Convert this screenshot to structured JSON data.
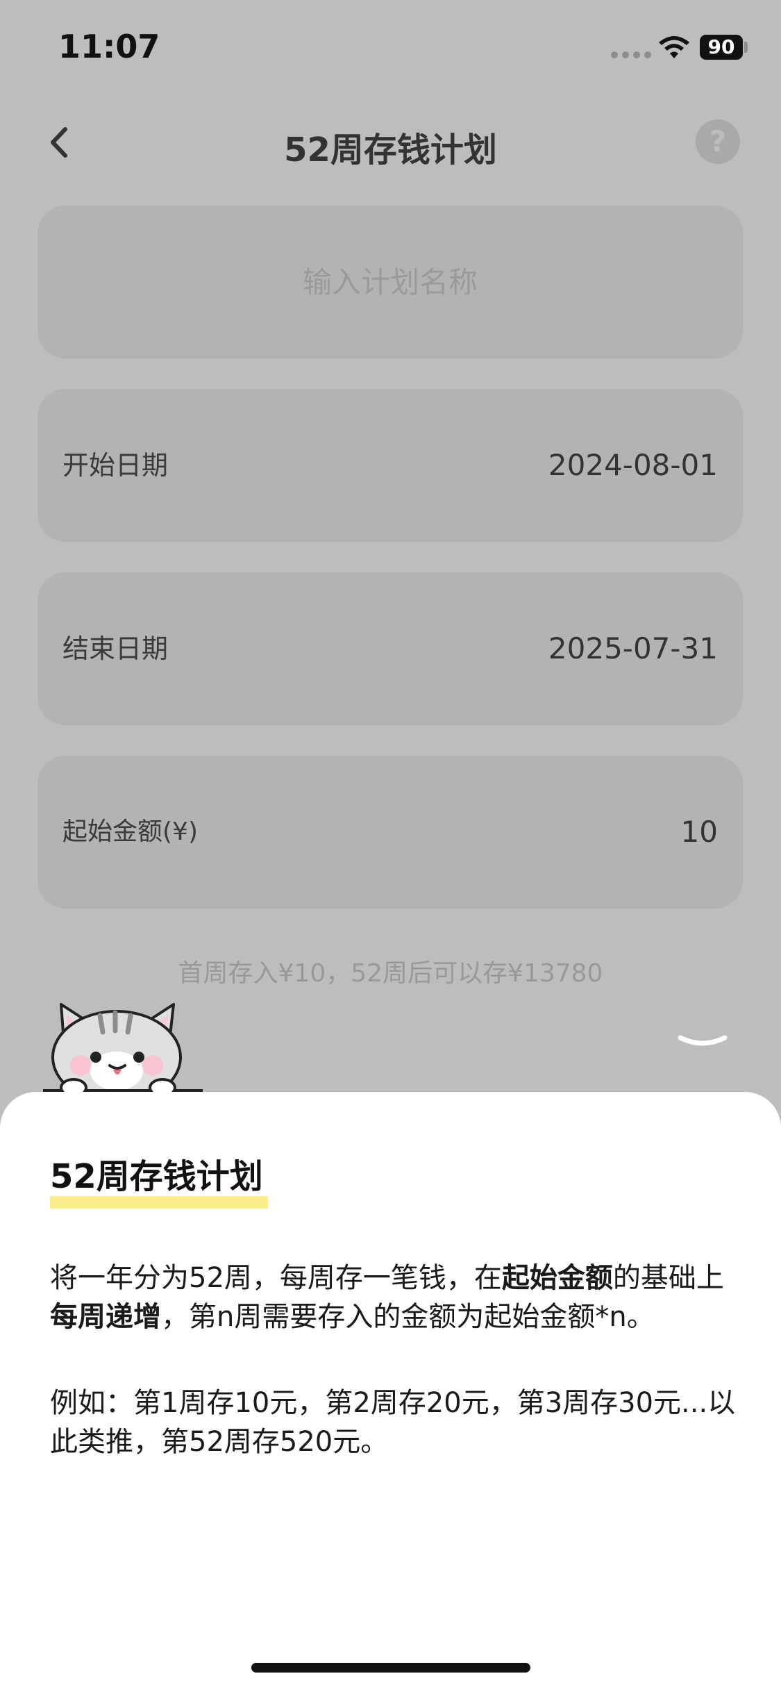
{
  "status_bar": {
    "time": "11:07",
    "battery": "90"
  },
  "nav": {
    "title": "52周存钱计划"
  },
  "form": {
    "name_placeholder": "输入计划名称",
    "name_value": "",
    "start_date_label": "开始日期",
    "start_date_value": "2024-08-01",
    "end_date_label": "结束日期",
    "end_date_value": "2025-07-31",
    "start_amount_label": "起始金额(¥)",
    "start_amount_value": "10"
  },
  "summary": "首周存入¥10，52周后可以存¥13780",
  "sheet": {
    "title": "52周存钱计划",
    "p1_a": "将一年分为52周，每周存一笔钱，在",
    "p1_b": "起始金额",
    "p1_c": "的基础上",
    "p1_d": "每周递增",
    "p1_e": "，第n周需要存入的金额为起始金额*n。",
    "p2": "例如：第1周存10元，第2周存20元，第3周存30元...以此类推，第52周存520元。"
  },
  "colors": {
    "overlay_bg": "#bdbdbd",
    "card_bg": "#b3b3b3",
    "sheet_bg": "#ffffff",
    "title_highlight": "#fbef8d"
  },
  "icons": [
    "back-chevron-icon",
    "help-icon",
    "wifi-icon",
    "cat-mascot-icon",
    "chevron-down-icon"
  ]
}
